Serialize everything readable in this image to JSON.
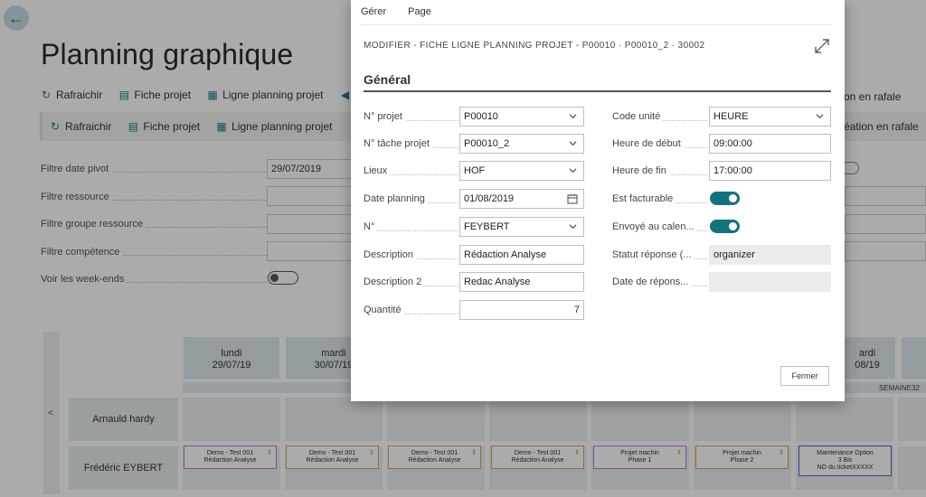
{
  "background": {
    "page_title": "Planning graphique",
    "toolbar1": [
      "Rafraichir",
      "Fiche projet",
      "Ligne planning projet"
    ],
    "toolbar1_right": "on en rafale",
    "toolbar2": [
      "Rafraichir",
      "Fiche projet",
      "Ligne planning projet"
    ],
    "toolbar2_right": "éation en rafale",
    "filters": [
      {
        "label": "Filtre date pivot",
        "value": "29/07/2019"
      },
      {
        "label": "Filtre ressource",
        "value": ""
      },
      {
        "label": "Filtre groupe ressource",
        "value": ""
      },
      {
        "label": "Filtre compétence",
        "value": ""
      }
    ],
    "weekend_label": "Voir les week-ends",
    "days": [
      {
        "name": "lundi",
        "date": "29/07/19"
      },
      {
        "name": "mardi",
        "date": "30/07/19"
      }
    ],
    "day_partial": {
      "name": "ardi",
      "date": "08/19"
    },
    "week_label": "SEMAINE32",
    "grid_arrow": "<",
    "resources": [
      "Arnauld hardy",
      "Frédéric EYBERT"
    ],
    "tasks": [
      {
        "line1": "Demo - Test 001",
        "line2": "Rédaction Analyse",
        "line3": "",
        "color": "#c07ad0"
      },
      {
        "line1": "Demo - Test 001",
        "line2": "Rédaction Analyse",
        "line3": "",
        "color": "#e0a060"
      },
      {
        "line1": "Demo - Test 001",
        "line2": "Rédaction Analyse",
        "line3": "",
        "color": "#e0a060"
      },
      {
        "line1": "Demo - Test 001",
        "line2": "Rédaction Analyse",
        "line3": "",
        "color": "#e0a060"
      },
      {
        "line1": "Projet machin",
        "line2": "Phase 1",
        "line3": "",
        "color": "#c07ad0"
      },
      {
        "line1": "Projet machin",
        "line2": "Phase 2",
        "line3": "",
        "color": "#e0a060"
      },
      {
        "line1": "Maintenance Option",
        "line2": "3 Bis",
        "line3": "NO du ticketXXXXX",
        "color": "#4b62c4"
      }
    ]
  },
  "modal": {
    "menu": [
      "Gérer",
      "Page"
    ],
    "heading": "MODIFIER - FICHE LIGNE PLANNING PROJET - P00010 · P00010_2 · 30002",
    "section": "Général",
    "left_fields": [
      {
        "label": "N° projet",
        "value": "P00010",
        "kind": "select"
      },
      {
        "label": "N° tâche projet",
        "value": "P00010_2",
        "kind": "select"
      },
      {
        "label": "Lieux",
        "value": "HOF",
        "kind": "select"
      },
      {
        "label": "Date planning",
        "value": "01/08/2019",
        "kind": "date"
      },
      {
        "label": "N°",
        "value": "FEYBERT",
        "kind": "select"
      },
      {
        "label": "Description",
        "value": "Rédaction Analyse",
        "kind": "text"
      },
      {
        "label": "Description 2",
        "value": "Redac Analyse",
        "kind": "text"
      },
      {
        "label": "Quantité",
        "value": "7",
        "kind": "number"
      }
    ],
    "right_fields": [
      {
        "label": "Code unité",
        "value": "HEURE",
        "kind": "select"
      },
      {
        "label": "Heure de début",
        "value": "09:00:00",
        "kind": "text"
      },
      {
        "label": "Heure de fin",
        "value": "17:00:00",
        "kind": "text"
      },
      {
        "label": "Est facturable",
        "value": "",
        "kind": "toggle"
      },
      {
        "label": "Envoyé au calen...",
        "value": "",
        "kind": "toggle"
      },
      {
        "label": "Statut réponse (...",
        "value": "organizer",
        "kind": "readonly"
      },
      {
        "label": "Date de répons...",
        "value": "",
        "kind": "readonly"
      }
    ],
    "close_label": "Fermer",
    "accent_color": "#12737e"
  }
}
